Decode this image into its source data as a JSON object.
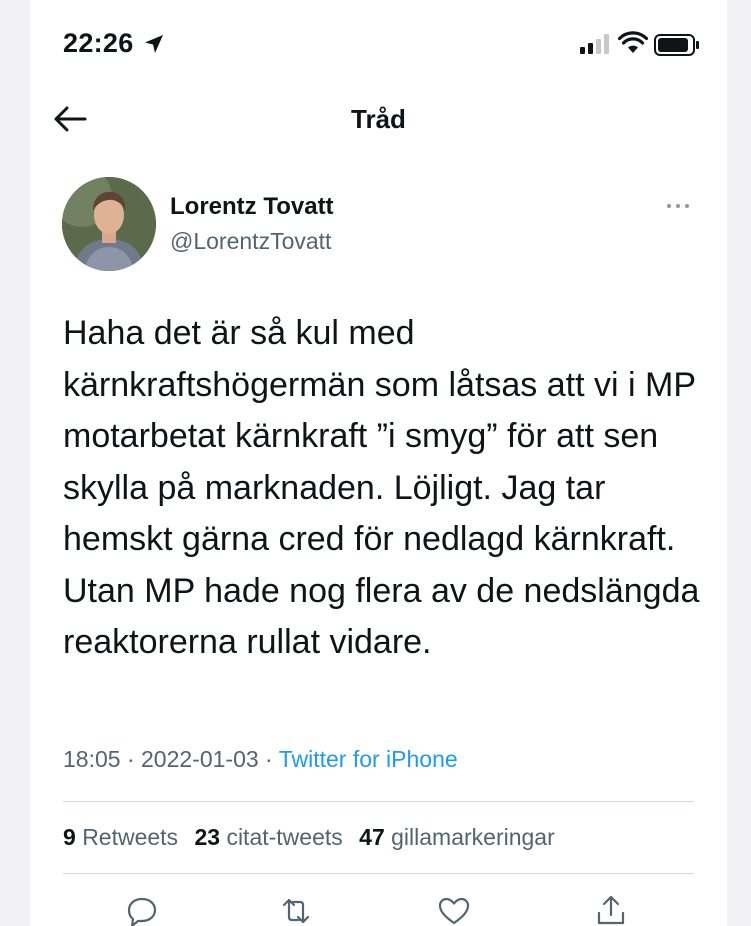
{
  "status_bar": {
    "time": "22:26"
  },
  "nav": {
    "title": "Tråd"
  },
  "tweet": {
    "author_name": "Lorentz Tovatt",
    "author_handle": "@LorentzTovatt",
    "text": "Haha det är så kul med kärnkraftshögermän som låtsas att vi i MP motarbetat kärnkraft ”i smyg” för att sen skylla på marknaden. Löjligt. Jag tar hemskt gärna cred för nedlagd kärnkraft. Utan MP hade nog flera av de nedslängda reaktorerna rullat vidare.",
    "time": "18:05",
    "date": "2022-01-03",
    "sep": " · ",
    "source": "Twitter for iPhone"
  },
  "stats": {
    "retweets_count": "9",
    "retweets_label": "Retweets",
    "quotes_count": "23",
    "quotes_label": "citat-tweets",
    "likes_count": "47",
    "likes_label": "gillamarkeringar"
  },
  "icons": {
    "back": "arrow-left-icon",
    "more": "more-horizontal-icon",
    "reply": "reply-icon",
    "retweet": "retweet-icon",
    "like": "heart-icon",
    "share": "share-icon"
  },
  "colors": {
    "link": "#1d9bf0",
    "secondary_text": "#536471",
    "primary_text": "#0f1419",
    "divider": "#cfd9de"
  }
}
